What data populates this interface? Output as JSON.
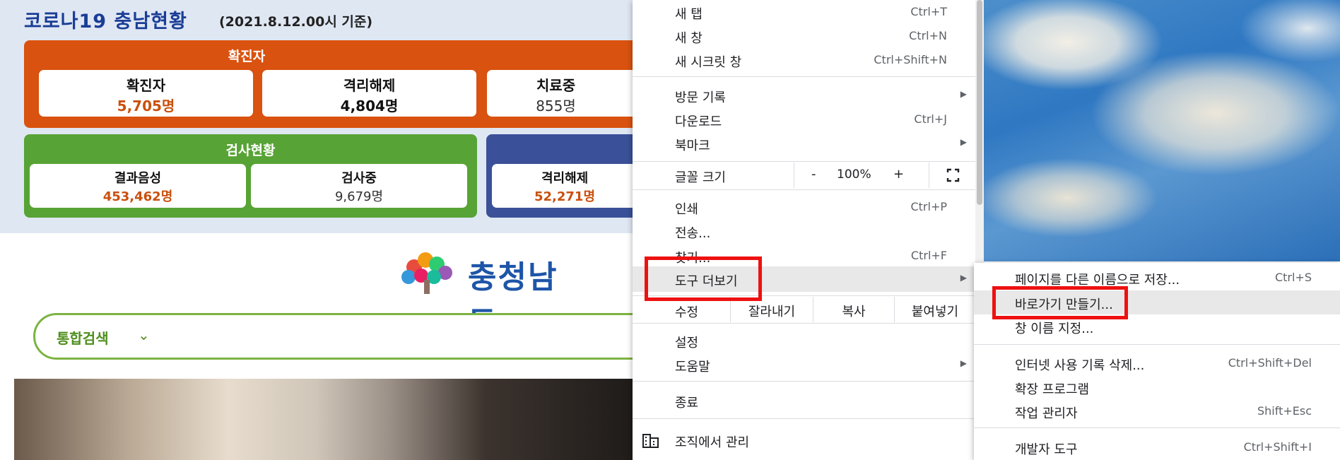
{
  "page": {
    "covid": {
      "title": "코로나19 충남현황",
      "date": "(2021.8.12.00시 기준)",
      "confirmed_header": "확진자",
      "cards": [
        {
          "label": "확진자",
          "value": "5,705명"
        },
        {
          "label": "격리해제",
          "value": "4,804명"
        },
        {
          "label": "치료중",
          "value": "855명"
        }
      ],
      "test_header": "검사현황",
      "test_cards": [
        {
          "label": "결과음성",
          "value": "453,462명"
        },
        {
          "label": "검사중",
          "value": "9,679명"
        }
      ],
      "quarantine_card": {
        "label": "격리해제",
        "value": "52,271명"
      }
    },
    "logo_text": "충청남도",
    "search": {
      "select": "통합검색",
      "chevron": "⌄"
    }
  },
  "menu": {
    "items": [
      {
        "label": "새 탭",
        "shortcut": "Ctrl+T"
      },
      {
        "label": "새 창",
        "shortcut": "Ctrl+N"
      },
      {
        "label": "새 시크릿 창",
        "shortcut": "Ctrl+Shift+N"
      },
      {
        "label": "방문 기록",
        "shortcut": ""
      },
      {
        "label": "다운로드",
        "shortcut": "Ctrl+J"
      },
      {
        "label": "북마크",
        "shortcut": ""
      },
      {
        "label": "인쇄",
        "shortcut": "Ctrl+P"
      },
      {
        "label": "전송...",
        "shortcut": ""
      },
      {
        "label": "찾기...",
        "shortcut": "Ctrl+F"
      },
      {
        "label": "도구 더보기",
        "shortcut": ""
      },
      {
        "label": "설정",
        "shortcut": ""
      },
      {
        "label": "도움말",
        "shortcut": ""
      },
      {
        "label": "종료",
        "shortcut": ""
      },
      {
        "label": "조직에서 관리",
        "shortcut": ""
      }
    ],
    "zoom": {
      "label": "글꼴 크기",
      "minus": "-",
      "value": "100%",
      "plus": "+"
    },
    "edit": {
      "label": "수정",
      "cut": "잘라내기",
      "copy": "복사",
      "paste": "붙여넣기"
    },
    "arrow": "▶"
  },
  "submenu": {
    "items": [
      {
        "label": "페이지를 다른 이름으로 저장...",
        "shortcut": "Ctrl+S"
      },
      {
        "label": "바로가기 만들기...",
        "shortcut": ""
      },
      {
        "label": "창 이름 지정...",
        "shortcut": ""
      },
      {
        "label": "인터넷 사용 기록 삭제...",
        "shortcut": "Ctrl+Shift+Del"
      },
      {
        "label": "확장 프로그램",
        "shortcut": ""
      },
      {
        "label": "작업 관리자",
        "shortcut": "Shift+Esc"
      },
      {
        "label": "개발자 도구",
        "shortcut": "Ctrl+Shift+I"
      }
    ]
  },
  "colors": {
    "highlight_red": "#ee1111",
    "menu_hover": "#e8e8e8"
  }
}
